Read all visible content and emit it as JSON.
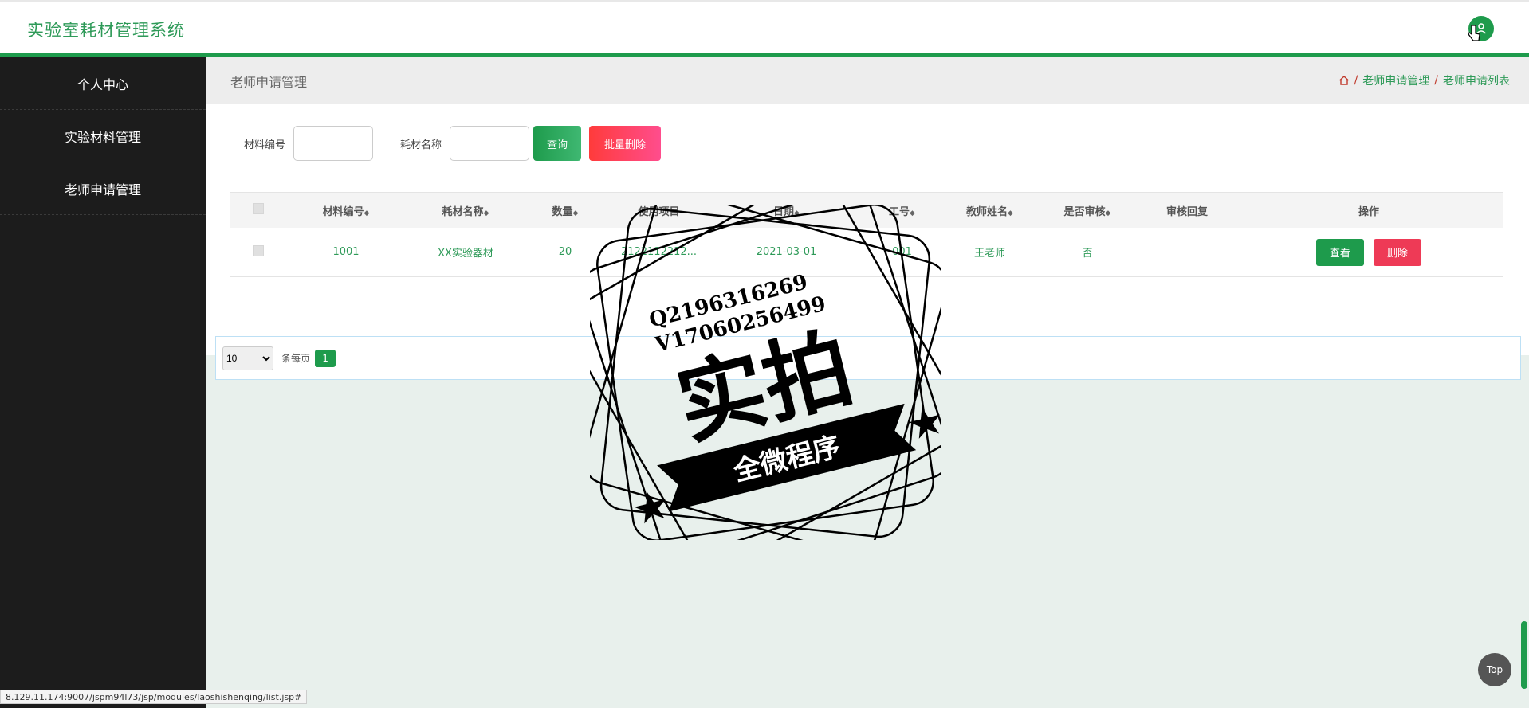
{
  "header": {
    "brand": "实验室耗材管理系统"
  },
  "sidebar": {
    "items": [
      {
        "label": "个人中心"
      },
      {
        "label": "实验材料管理"
      },
      {
        "label": "老师申请管理"
      }
    ]
  },
  "titlebar": {
    "title": "老师申请管理"
  },
  "breadcrumb": {
    "items": [
      "老师申请管理",
      "老师申请列表"
    ],
    "separator": "/"
  },
  "search": {
    "field1_label": "材料编号",
    "field1_value": "",
    "field2_label": "耗材名称",
    "field2_value": "",
    "query_label": "查询",
    "batch_delete_label": "批量删除"
  },
  "table": {
    "columns": [
      "材料编号",
      "耗材名称",
      "数量",
      "使用项目",
      "日期",
      "工号",
      "教师姓名",
      "是否审核",
      "审核回复",
      "操作"
    ],
    "sort_glyph": "◆",
    "rows": [
      {
        "material_no": "1001",
        "consumable_name": "XX实验器材",
        "quantity": "20",
        "project": "2122112212...",
        "date": "2021-03-01",
        "job_no": "001",
        "teacher_name": "王老师",
        "audited": "否",
        "reply": "",
        "view_label": "查看",
        "delete_label": "删除"
      }
    ]
  },
  "pager": {
    "page_size": "10",
    "page_size_options": [
      "10"
    ],
    "per_page_label": "条每页",
    "current_page": "1"
  },
  "watermark": {
    "line1": "Q2196316269",
    "line2": "V17060256499",
    "main": "实拍",
    "ribbon": "全微程序"
  },
  "statusbar": {
    "url": "8.129.11.174:9007/jspm94l73/jsp/modules/laoshishenqing/list.jsp#"
  },
  "top_button": {
    "label": "Top"
  },
  "colors": {
    "accent": "#1e9b4c",
    "danger": "#ee3a56",
    "sidebar": "#1c1c1c"
  },
  "icons": {
    "home": "home-icon",
    "user": "user-icon",
    "cursor": "hand-cursor-icon"
  }
}
